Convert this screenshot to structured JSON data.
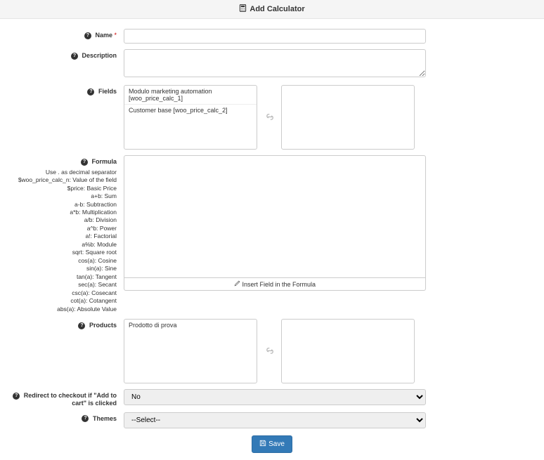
{
  "header": {
    "title": "Add Calculator"
  },
  "labels": {
    "name": "Name",
    "description": "Description",
    "fields": "Fields",
    "formula": "Formula",
    "products": "Products",
    "redirect": "Redirect to checkout if \"Add to cart\" is clicked",
    "themes": "Themes"
  },
  "required_mark": "*",
  "name_value": "",
  "description_value": "",
  "fields_list": [
    "Modulo marketing automation [woo_price_calc_1]",
    "Customer base [woo_price_calc_2]"
  ],
  "formula_hints": [
    "Use . as decimal separator",
    "$woo_price_calc_n: Value of the field",
    "$price: Basic Price",
    "a+b: Sum",
    "a-b: Subtraction",
    "a*b: Multiplication",
    "a/b: Division",
    "a^b: Power",
    "a!: Factorial",
    "a%b: Module",
    "sqrt: Square root",
    "cos(a): Cosine",
    "sin(a): Sine",
    "tan(a): Tangent",
    "sec(a): Secant",
    "csc(a): Cosecant",
    "cot(a): Cotangent",
    "abs(a): Absolute Value"
  ],
  "formula_footer": "Insert Field in the Formula",
  "products_list": [
    "Prodotto di prova"
  ],
  "redirect_options": {
    "selected": "No"
  },
  "themes_options": {
    "selected": "--Select--"
  },
  "buttons": {
    "save": "Save"
  }
}
